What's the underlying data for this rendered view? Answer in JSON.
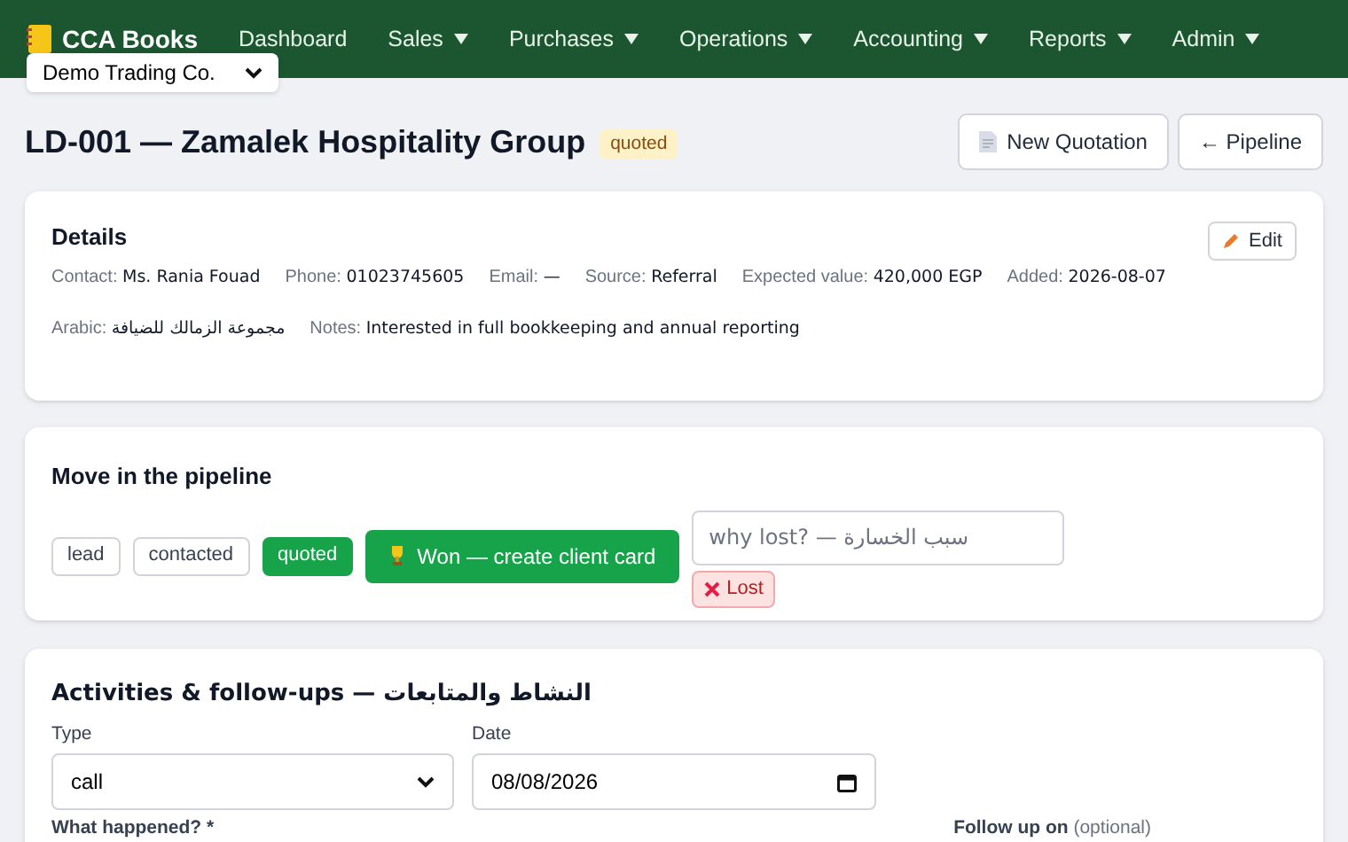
{
  "app": {
    "logo": "CCA Books"
  },
  "nav": [
    {
      "label": "Dashboard",
      "dropdown": false
    },
    {
      "label": "Sales",
      "dropdown": true
    },
    {
      "label": "Purchases",
      "dropdown": true
    },
    {
      "label": "Operations",
      "dropdown": true
    },
    {
      "label": "Accounting",
      "dropdown": true
    },
    {
      "label": "Reports",
      "dropdown": true
    },
    {
      "label": "Admin",
      "dropdown": true
    }
  ],
  "company_select": {
    "value": "Demo Trading Co."
  },
  "header": {
    "title": "LD-001 — Zamalek Hospitality Group",
    "badge": "quoted",
    "buttons": [
      {
        "kind": "quotation",
        "label": "New Quotation"
      },
      {
        "kind": "back",
        "label": "← Pipeline"
      }
    ]
  },
  "details": {
    "title": "Details",
    "edit": "Edit",
    "fields": [
      {
        "label": "Contact:",
        "value": "Ms. Rania Fouad"
      },
      {
        "label": "Phone:",
        "value": "01023745605"
      },
      {
        "label": "Email:",
        "value": "—"
      },
      {
        "label": "Source:",
        "value": "Referral"
      },
      {
        "label": "Expected value:",
        "value": "420,000 EGP"
      },
      {
        "label": "Added:",
        "value": "2026-08-07"
      },
      {
        "label": "Arabic:",
        "value": "مجموعة الزمالك للضيافة"
      },
      {
        "label": "Notes:",
        "value": "Interested in full bookkeeping and annual reporting"
      }
    ]
  },
  "pipeline": {
    "title": "Move in the pipeline",
    "stages": [
      {
        "label": "lead",
        "selected": false
      },
      {
        "label": "contacted",
        "selected": false
      },
      {
        "label": "quoted",
        "selected": true
      }
    ],
    "won": "Won — create client card",
    "lost_reason": {
      "placeholder": "why lost? — سبب الخسارة"
    },
    "lost": "Lost"
  },
  "activities": {
    "title": "Activities & follow-ups — النشاط والمتابعات",
    "type": {
      "label": "Type",
      "value": "call"
    },
    "date": {
      "label": "Date",
      "value": "08/08/2026"
    },
    "what": {
      "label": "What happened? *"
    },
    "follow": {
      "label": "Follow up on",
      "hint": "(optional)"
    }
  }
}
